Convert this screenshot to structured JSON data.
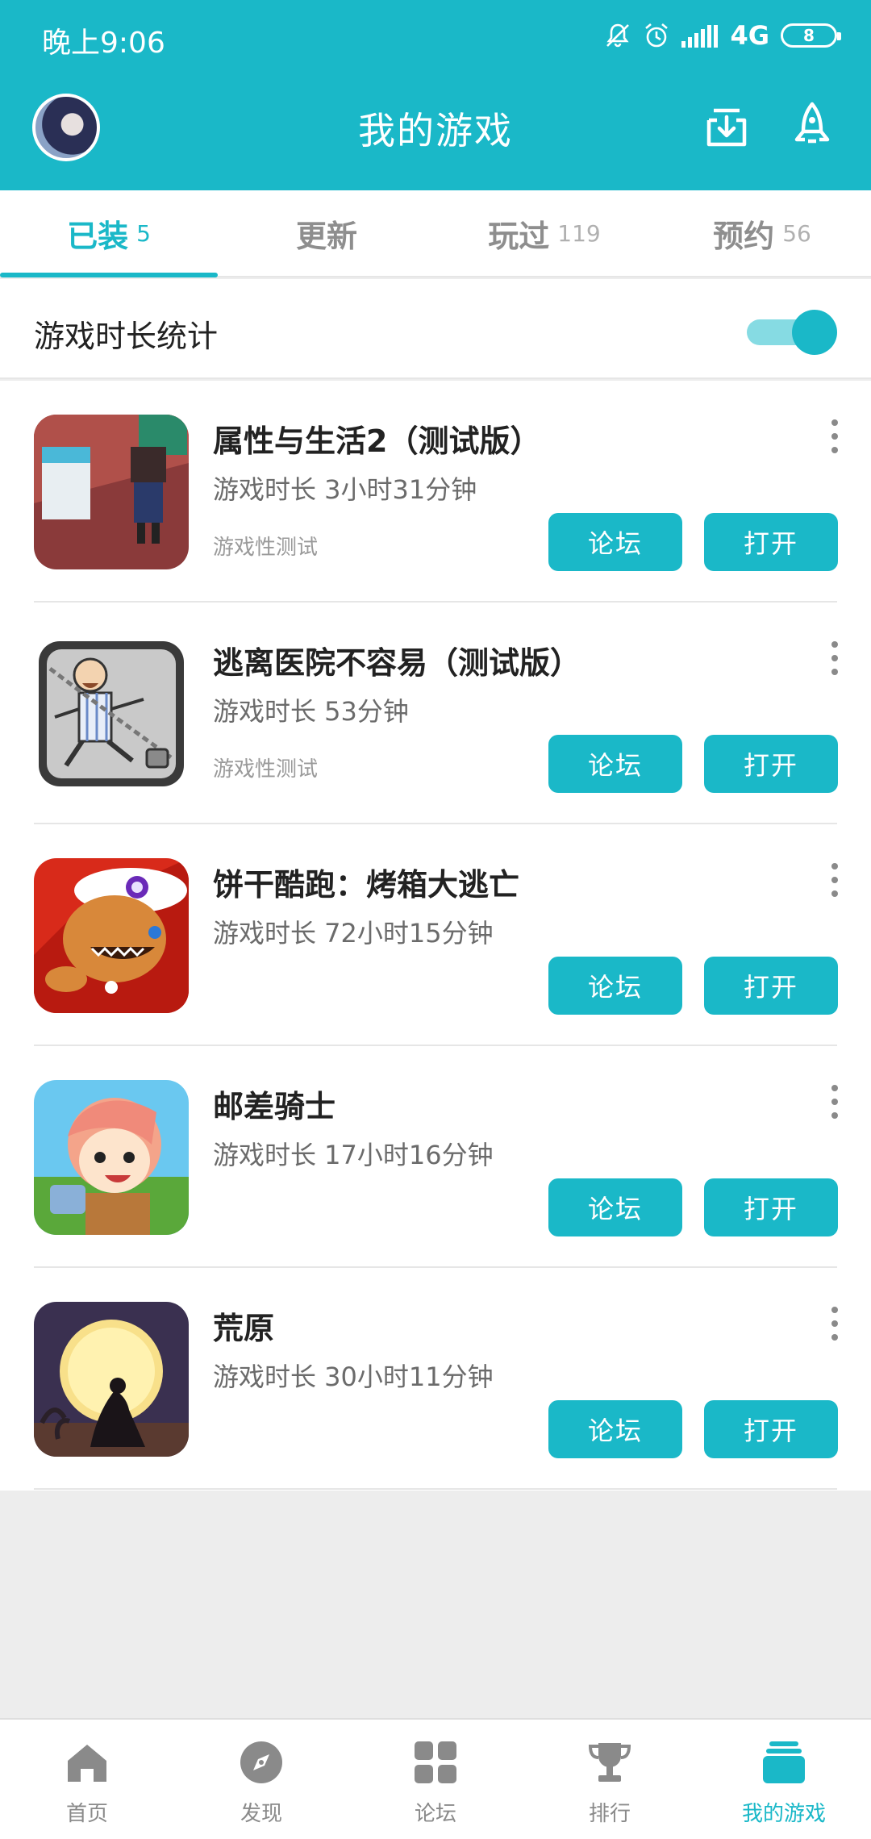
{
  "status_bar": {
    "time": "晚上9:06",
    "network": "4G",
    "battery": "8"
  },
  "header": {
    "title": "我的游戏"
  },
  "tabs": [
    {
      "label": "已装",
      "count": "5",
      "active": true
    },
    {
      "label": "更新",
      "count": "",
      "active": false
    },
    {
      "label": "玩过",
      "count": "119",
      "active": false
    },
    {
      "label": "预约",
      "count": "56",
      "active": false
    }
  ],
  "stats_toggle": {
    "label": "游戏时长统计",
    "on": true
  },
  "games": [
    {
      "name": "属性与生活2（测试版）",
      "playtime": "游戏时长 3小时31分钟",
      "tag": "游戏性测试",
      "forum_label": "论坛",
      "open_label": "打开"
    },
    {
      "name": "逃离医院不容易（测试版）",
      "playtime": "游戏时长 53分钟",
      "tag": "游戏性测试",
      "forum_label": "论坛",
      "open_label": "打开"
    },
    {
      "name": "饼干酷跑：烤箱大逃亡",
      "playtime": "游戏时长 72小时15分钟",
      "tag": "",
      "forum_label": "论坛",
      "open_label": "打开"
    },
    {
      "name": "邮差骑士",
      "playtime": "游戏时长 17小时16分钟",
      "tag": "",
      "forum_label": "论坛",
      "open_label": "打开"
    },
    {
      "name": "荒原",
      "playtime": "游戏时长 30小时11分钟",
      "tag": "",
      "forum_label": "论坛",
      "open_label": "打开"
    }
  ],
  "bottom_nav": [
    {
      "label": "首页",
      "icon": "home-icon",
      "active": false
    },
    {
      "label": "发现",
      "icon": "compass-icon",
      "active": false
    },
    {
      "label": "论坛",
      "icon": "grid-icon",
      "active": false
    },
    {
      "label": "排行",
      "icon": "trophy-icon",
      "active": false
    },
    {
      "label": "我的游戏",
      "icon": "stack-icon",
      "active": true
    }
  ],
  "colors": {
    "accent": "#1ab8c8",
    "toggle_track": "#86dbe3",
    "background": "#ededed"
  }
}
